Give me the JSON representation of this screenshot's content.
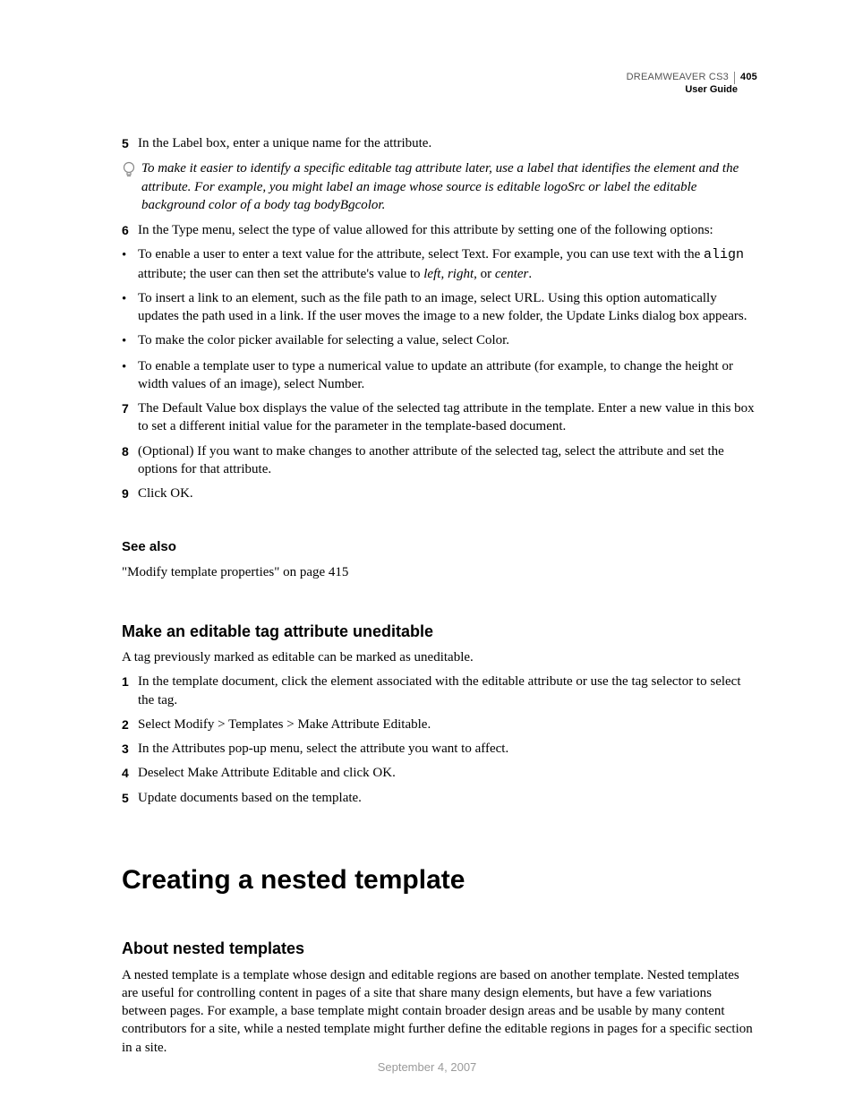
{
  "header": {
    "product": "DREAMWEAVER CS3",
    "page_number": "405",
    "doc_title": "User Guide"
  },
  "steps_a": {
    "s5_num": "5",
    "s5_text": "In the Label box, enter a unique name for the attribute.",
    "tip_text": "To make it easier to identify a specific editable tag attribute later, use a label that identifies the element and the attribute. For example, you might label an image whose source is editable logoSrc or label the editable background color of a body tag bodyBgcolor.",
    "s6_num": "6",
    "s6_text": "In the Type menu, select the type of value allowed for this attribute by setting one of the following options:",
    "b1_pre": "To enable a user to enter a text value for the attribute, select Text. For example, you can use text with the ",
    "b1_code": "align",
    "b1_mid": " attribute; the user can then set the attribute's value to ",
    "b1_i1": "left",
    "b1_sep1": ", ",
    "b1_i2": "right",
    "b1_sep2": ", or ",
    "b1_i3": "center",
    "b1_end": ".",
    "b2": "To insert a link to an element, such as the file path to an image, select URL. Using this option automatically updates the path used in a link. If the user moves the image to a new folder, the Update Links dialog box appears.",
    "b3": "To make the color picker available for selecting a value, select Color.",
    "b4": "To enable a template user to type a numerical value to update an attribute (for example, to change the height or width values of an image), select Number.",
    "s7_num": "7",
    "s7_text": "The Default Value box displays the value of the selected tag attribute in the template. Enter a new value in this box to set a different initial value for the parameter in the template-based document.",
    "s8_num": "8",
    "s8_text": "(Optional) If you want to make changes to another attribute of the selected tag, select the attribute and set the options for that attribute.",
    "s9_num": "9",
    "s9_text": "Click OK."
  },
  "see_also": {
    "heading": "See also",
    "link": "\"Modify template properties\" on page 415"
  },
  "section_uneditable": {
    "heading": "Make an editable tag attribute uneditable",
    "intro": "A tag previously marked as editable can be marked as uneditable.",
    "s1_num": "1",
    "s1_text": "In the template document, click the element associated with the editable attribute or use the tag selector to select the tag.",
    "s2_num": "2",
    "s2_text": "Select Modify > Templates > Make Attribute Editable.",
    "s3_num": "3",
    "s3_text": "In the Attributes pop-up menu, select the attribute you want to affect.",
    "s4_num": "4",
    "s4_text": "Deselect Make Attribute Editable and click OK.",
    "s5_num": "5",
    "s5_text": "Update documents based on the template."
  },
  "section_nested": {
    "h1": "Creating a nested template",
    "h3": "About nested templates",
    "para": "A nested template is a template whose design and editable regions are based on another template. Nested templates are useful for controlling content in pages of a site that share many design elements, but have a few variations between pages. For example, a base template might contain broader design areas and be usable by many content contributors for a site, while a nested template might further define the editable regions in pages for a specific section in a site."
  },
  "footer_date": "September 4, 2007"
}
